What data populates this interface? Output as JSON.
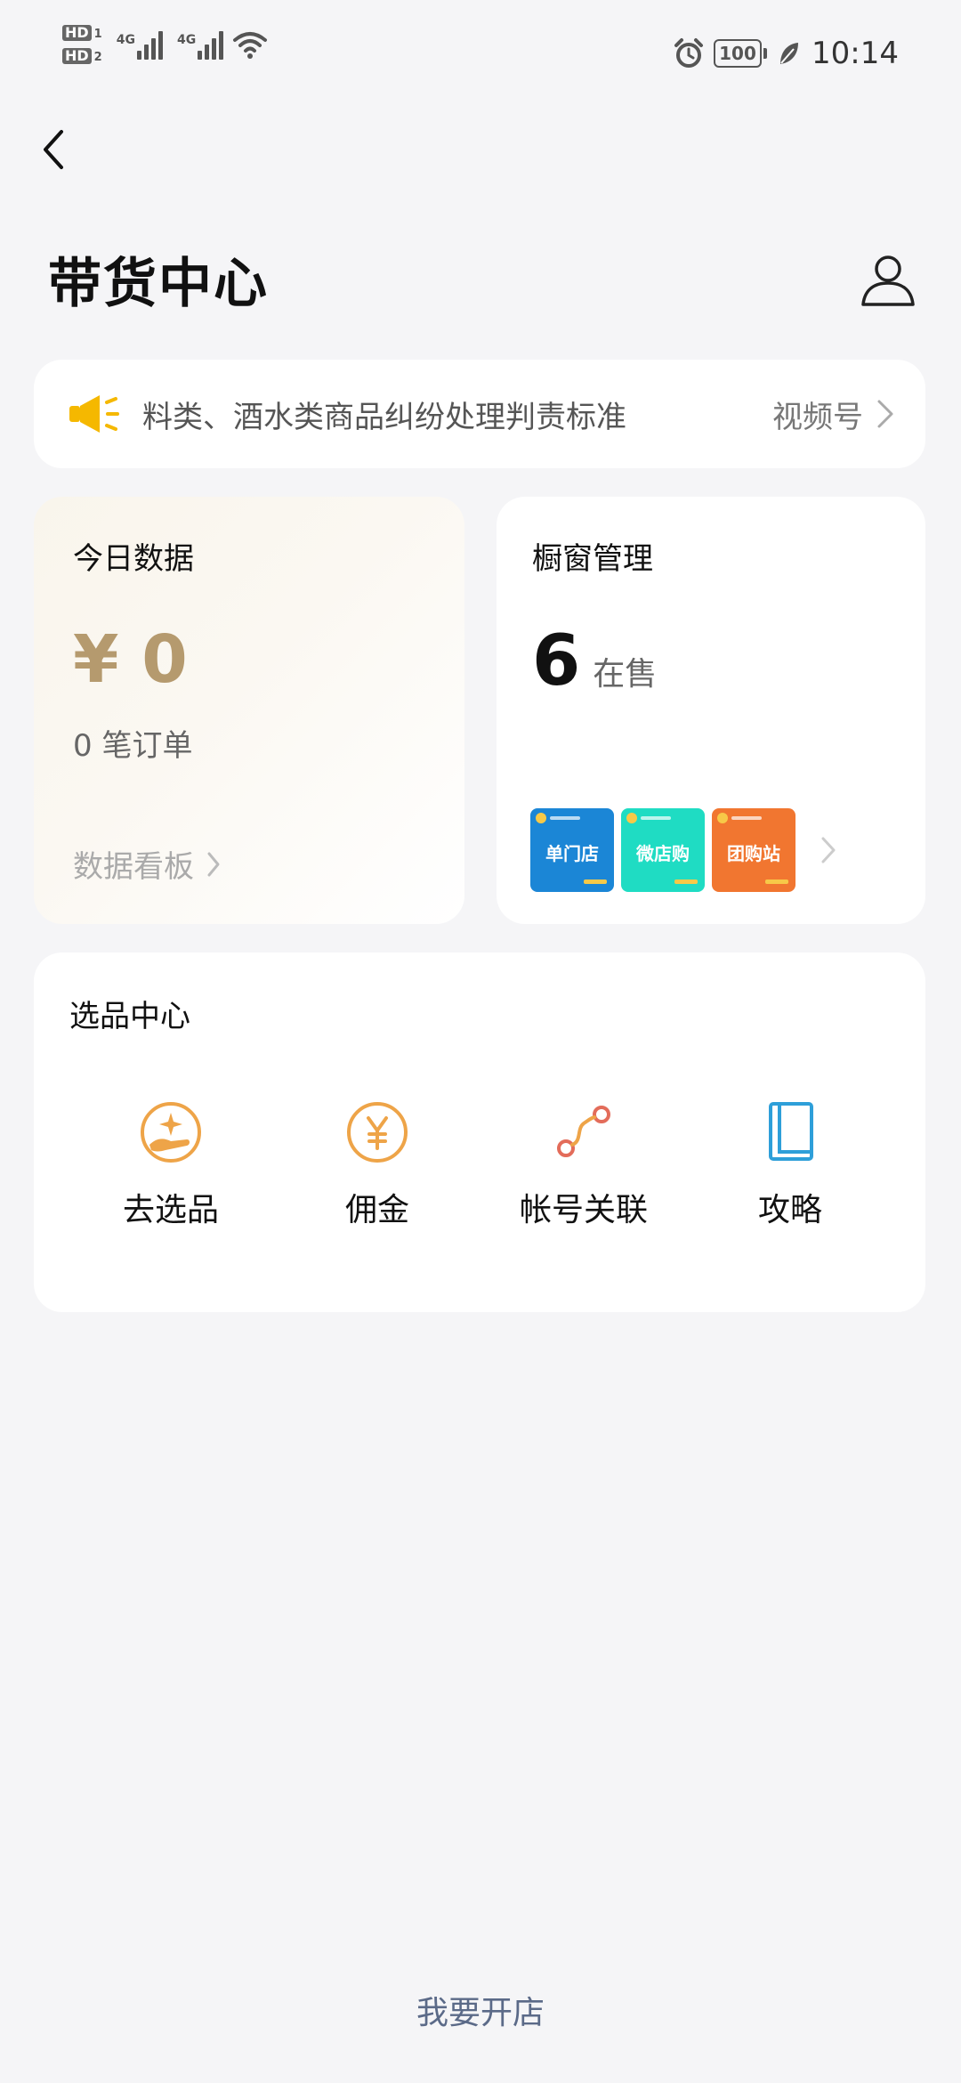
{
  "status_bar": {
    "sim1_label": "HD",
    "sim1_index": "1",
    "sim2_label": "HD",
    "sim2_index": "2",
    "network_1": "4G",
    "network_2": "4G",
    "battery": "100",
    "time": "10:14"
  },
  "header": {
    "title": "带货中心"
  },
  "notice": {
    "text": "料类、酒水类商品纠纷处理判责标准",
    "tag": "视频号",
    "icon": "megaphone-icon"
  },
  "today": {
    "title": "今日数据",
    "amount": "¥ 0",
    "orders": "0 笔订单",
    "link": "数据看板"
  },
  "window": {
    "title": "橱窗管理",
    "count": "6",
    "unit": "在售",
    "thumbs": [
      {
        "text": "单门店",
        "color": "#1b86d6"
      },
      {
        "text": "微店购",
        "color": "#1fdcc3"
      },
      {
        "text": "团购站",
        "color": "#f17630"
      }
    ]
  },
  "picks": {
    "title": "选品中心",
    "items": [
      {
        "label": "去选品",
        "icon": "sparkle-hand-icon"
      },
      {
        "label": "佣金",
        "icon": "yen-circle-icon"
      },
      {
        "label": "帐号关联",
        "icon": "link-path-icon"
      },
      {
        "label": "攻略",
        "icon": "book-icon"
      }
    ]
  },
  "footer": {
    "open_shop": "我要开店"
  },
  "colors": {
    "accent_orange": "#eea448",
    "gold_amount": "#b59a6e",
    "link_blue": "#5b6a88",
    "book_blue": "#2e9fd9",
    "link_red": "#e36c5a",
    "megaphone": "#f5b800"
  }
}
